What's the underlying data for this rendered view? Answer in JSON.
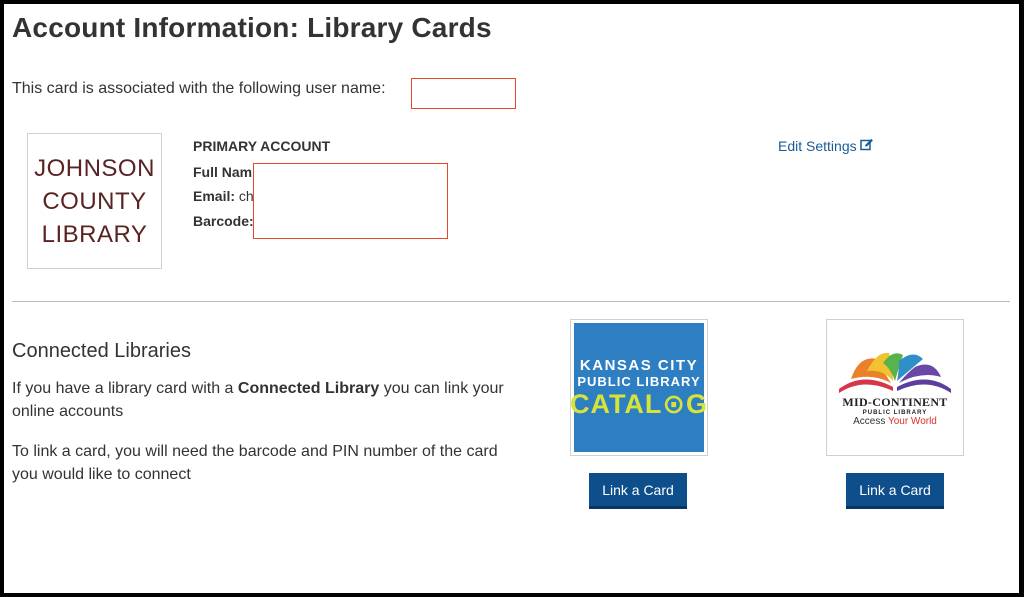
{
  "page": {
    "title": "Account Information: Library Cards",
    "association_text": "This card is associated with the following user name:"
  },
  "primary_account": {
    "logo_lines": [
      "JOHNSON",
      "COUNTY",
      "LIBRARY"
    ],
    "heading": "PRIMARY ACCOUNT",
    "full_name_label": "Full Nam",
    "email_label": "Email:",
    "email_value": "ch",
    "barcode_label": "Barcode:",
    "edit_label": "Edit Settings",
    "edit_icon": "edit-icon"
  },
  "connected": {
    "title": "Connected Libraries",
    "para1_before": "If you have a library card with a ",
    "para1_bold": "Connected Library",
    "para1_after": " you can link your online accounts",
    "para2": "To link a card, you will need the barcode and PIN number of the card you would like to connect",
    "libraries": [
      {
        "logo_lines": [
          "KANSAS CITY",
          "PUBLIC LIBRARY",
          "CATAL⊙G"
        ],
        "button_label": "Link a Card"
      },
      {
        "logo_name": "MID-CONTINENT",
        "logo_sub": "PUBLIC LIBRARY",
        "logo_tag_a": "Access ",
        "logo_tag_b": "Your World",
        "button_label": "Link a Card"
      }
    ]
  },
  "colors": {
    "link": "#1a5c96",
    "button": "#0e4f8b",
    "redaction": "#e8472c",
    "jcl_brand": "#5a2323",
    "kc_blue": "#2d7fc1",
    "kc_green": "#d8e33a"
  }
}
